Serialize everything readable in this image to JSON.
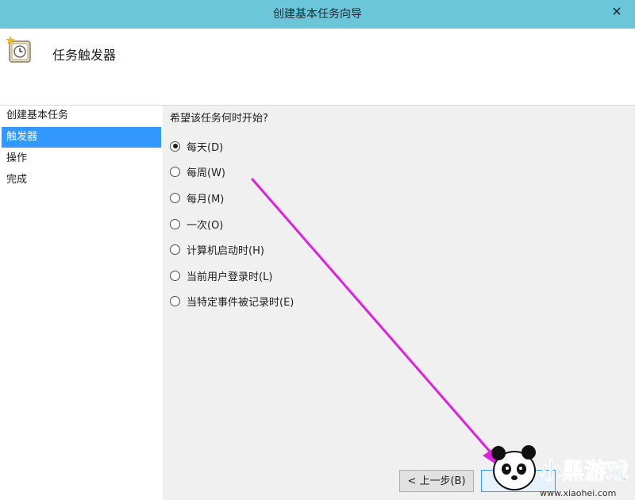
{
  "window": {
    "title": "创建基本任务向导",
    "close_glyph": "✕"
  },
  "header": {
    "icon": "task-clock-icon",
    "title": "任务触发器"
  },
  "sidebar": {
    "items": [
      {
        "label": "创建基本任务",
        "active": false
      },
      {
        "label": "触发器",
        "active": true
      },
      {
        "label": "操作",
        "active": false
      },
      {
        "label": "完成",
        "active": false
      }
    ]
  },
  "main": {
    "question": "希望该任务何时开始?",
    "options": [
      {
        "label": "每天(D)",
        "checked": true
      },
      {
        "label": "每周(W)",
        "checked": false
      },
      {
        "label": "每月(M)",
        "checked": false
      },
      {
        "label": "一次(O)",
        "checked": false
      },
      {
        "label": "计算机启动时(H)",
        "checked": false
      },
      {
        "label": "当前用户登录时(L)",
        "checked": false
      },
      {
        "label": "当特定事件被记录时(E)",
        "checked": false
      }
    ]
  },
  "footer": {
    "back_label": "< 上一步(B)"
  },
  "watermark": {
    "brand": "小黑游戏",
    "url": "www.xiaohei.com"
  },
  "colors": {
    "titlebar": "#6cc6d9",
    "accent": "#3399ff",
    "annotation_arrow": "#e020e0"
  }
}
